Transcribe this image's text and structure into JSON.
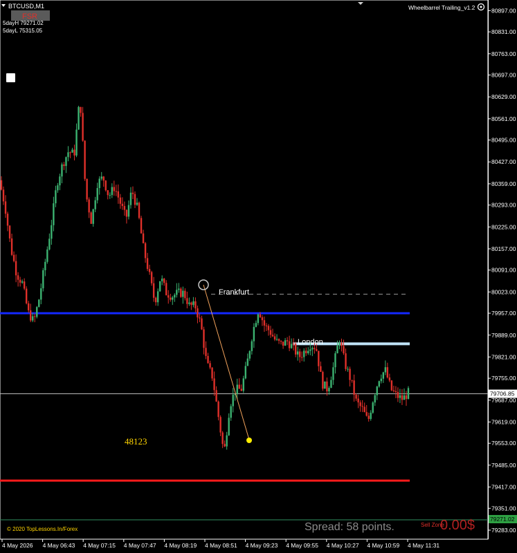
{
  "header": {
    "symbol": "BTCUSD,M1",
    "fsr_label": "FSR",
    "sday_high": "5dayH 79271.02",
    "sday_low": "5dayL 75315.05",
    "indicator_title": "Wheelbarrel Trailing_v1.2"
  },
  "annotations": {
    "frankfurt": "Frankfurt",
    "london": "London",
    "count": "48123",
    "copyright": "© 2020 TopLessons.In/Forex",
    "spread": "Spread: 58 points.",
    "sell_zone": "Sell Zone",
    "profit": "0.00$"
  },
  "colors": {
    "background": "#000000",
    "bull": "#3cb371",
    "bear": "#e0302a",
    "blue_line": "#1428ff",
    "red_line": "#ff1a1a",
    "london_bar": "#bfe3f7",
    "yellow_text": "#ffd400",
    "current_price_line": "#c0c0c0"
  },
  "chart_data": {
    "type": "candlestick",
    "price_axis_labels": [
      "80897.00",
      "80831.00",
      "80763.00",
      "80697.00",
      "80629.00",
      "80561.00",
      "80495.00",
      "80427.00",
      "80359.00",
      "80293.00",
      "80225.00",
      "80157.00",
      "80091.00",
      "80023.00",
      "79957.00",
      "79889.00",
      "79821.00",
      "79755.00",
      "79687.00",
      "79619.00",
      "79553.00",
      "79485.00",
      "79417.00",
      "79351.00",
      "79283.00"
    ],
    "time_axis_labels": [
      "4 May 2026",
      "4 May 06:43",
      "4 May 07:15",
      "4 May 07:47",
      "4 May 08:19",
      "4 May 08:51",
      "4 May 09:23",
      "4 May 09:55",
      "4 May 10:27",
      "4 May 10:59",
      "4 May 11:31"
    ],
    "current_price": "79706.85",
    "green_price_tag": "79271.02",
    "ylim": [
      79255,
      80930
    ],
    "levels": {
      "blue_support": 79957,
      "red_line": 79437,
      "london_line": 79862,
      "dashed_line": 80016
    },
    "price_path": [
      80370,
      80290,
      80160,
      80080,
      80050,
      79960,
      79930,
      80010,
      80120,
      80230,
      80360,
      80420,
      80460,
      80450,
      80630,
      80330,
      80240,
      80360,
      80380,
      80320,
      80350,
      80300,
      80250,
      80340,
      80280,
      80160,
      80080,
      79990,
      80070,
      80020,
      80010,
      80020,
      80020,
      79980,
      79980,
      79920,
      79800,
      79760,
      79640,
      79520,
      79670,
      79720,
      79720,
      79800,
      79900,
      79970,
      79920,
      79900,
      79870,
      79860,
      79870,
      79850,
      79820,
      79840,
      79860,
      79850,
      79740,
      79720,
      79790,
      79880,
      79800,
      79750,
      79680,
      79660,
      79620,
      79700,
      79760,
      79780,
      79720,
      79700,
      79690,
      79710
    ]
  }
}
